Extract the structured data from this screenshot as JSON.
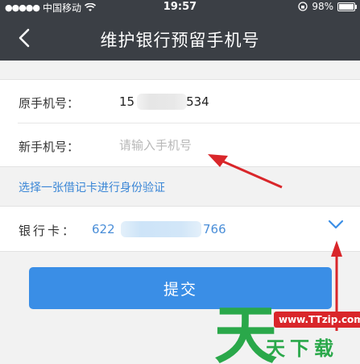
{
  "status_bar": {
    "signal_dots": "●●●●●",
    "carrier": "中国移动",
    "wifi_icon": "wifi-icon",
    "time": "19:57",
    "lock_icon": "rotation-lock-icon",
    "battery_percent": "98%",
    "battery_level": 0.98
  },
  "nav": {
    "back_icon": "chevron-left-icon",
    "title": "维护银行预留手机号"
  },
  "form": {
    "original_phone_label": "原手机号：",
    "original_phone_value_start": "15",
    "original_phone_value_end": "534",
    "new_phone_label": "新手机号：",
    "new_phone_placeholder": "请输入手机号"
  },
  "verify_link": "选择一张借记卡进行身份验证",
  "bank_card": {
    "label": "银行卡：",
    "value_start": "622",
    "value_end": "766",
    "dropdown_icon": "chevron-down-icon"
  },
  "submit_label": "提交",
  "watermark": {
    "site": "www.TTzip.com",
    "logo_char": "天",
    "text": "天下载"
  },
  "colors": {
    "nav_bg": "#3b3f45",
    "accent_blue": "#3a8ee6",
    "link_blue": "#3a86d6",
    "annotation_red": "#d9262a",
    "watermark_green": "#2aa84a"
  }
}
